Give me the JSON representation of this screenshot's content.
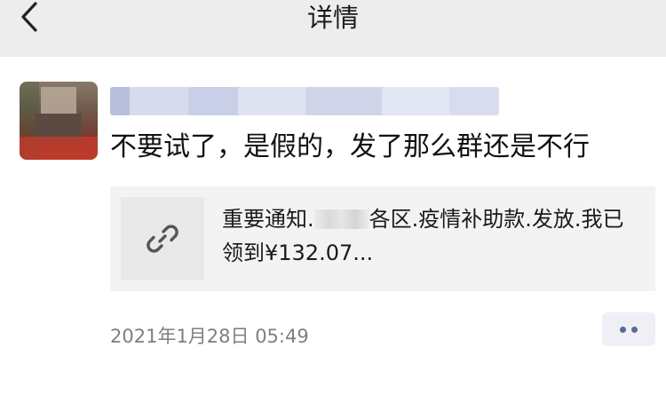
{
  "header": {
    "title": "详情",
    "back_icon": "chevron-left-icon"
  },
  "post": {
    "avatar": "blurred-avatar",
    "author_name": "",
    "message": "不要试了，是假的，发了那么群还是不行",
    "link": {
      "icon": "link-icon",
      "text_part1": "重要通知.",
      "text_part2": "各区.疫情补助款.发放.我已领到¥132.07..."
    },
    "timestamp": "2021年1月28日 05:49",
    "more_icon": "more-dots-icon"
  },
  "colors": {
    "header_bg": "#ededed",
    "card_bg": "#f3f3f3",
    "accent": "#576b95",
    "timestamp": "#7f7f7f"
  }
}
